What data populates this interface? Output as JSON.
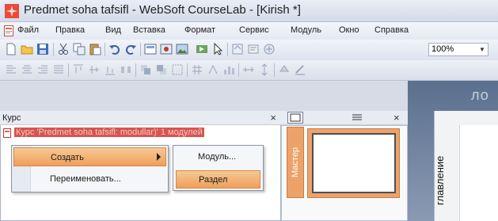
{
  "window": {
    "title": "Predmet soha tafsifl - WebSoft CourseLab - [Kirish *]"
  },
  "menubar": {
    "items": [
      "Файл",
      "Правка",
      "Вид",
      "Вставка",
      "Формат",
      "Сервис",
      "Модуль",
      "Окно",
      "Справка"
    ]
  },
  "toolbar": {
    "zoom": "100%"
  },
  "course_pane": {
    "title": "Курс",
    "close": "×",
    "course_item": "Курс 'Predmet soha tafsifl: modullar)' 1 модулей"
  },
  "context_menu": {
    "items": [
      {
        "label": "Создать",
        "has_submenu": true,
        "highlighted": true
      },
      {
        "label": "Переименовать...",
        "has_submenu": false,
        "highlighted": false
      }
    ],
    "submenu": [
      {
        "label": "Модуль...",
        "highlighted": false
      },
      {
        "label": "Раздел",
        "highlighted": true
      }
    ]
  },
  "slides_pane": {
    "master_label": "Мастер",
    "close": "×"
  },
  "editor": {
    "vertical_tab": "главление",
    "top_text": "ло"
  },
  "colors": {
    "highlight": "#ef9f5b",
    "master_tab": "#eda26a",
    "app_icon": "#e94a3c"
  }
}
